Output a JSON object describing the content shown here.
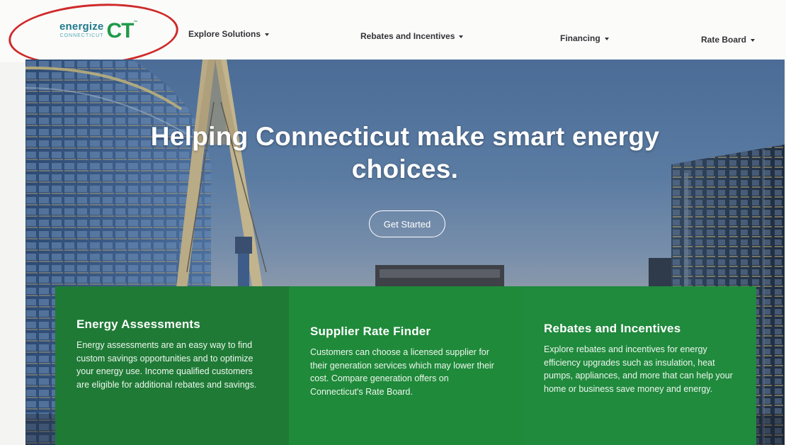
{
  "logo": {
    "word": "energize",
    "sub": "CONNECTICUT",
    "mark": "CT",
    "tm": "™"
  },
  "nav": {
    "items": [
      {
        "label": "Explore Solutions"
      },
      {
        "label": "Rebates and Incentives"
      },
      {
        "label": "Financing"
      },
      {
        "label": "Rate Board"
      }
    ]
  },
  "hero": {
    "title_line1": "Helping Connecticut make smart energy",
    "title_line2": "choices.",
    "cta_label": "Get Started"
  },
  "cards": [
    {
      "title": "Energy Assessments",
      "body": "Energy assessments are an easy way to find custom savings opportunities and to optimize your energy use. Income qualified customers are eligible for additional rebates and savings."
    },
    {
      "title": "Supplier Rate Finder",
      "body": "Customers can choose a licensed supplier for their generation services which may lower their cost. Compare generation offers on Connecticut's Rate Board."
    },
    {
      "title": "Rebates and Incentives",
      "body": "Explore rebates and incentives for energy efficiency upgrades such as insulation, heat pumps, appliances, and more that can help your home or business save money and energy."
    }
  ],
  "colors": {
    "brand_green": "#1f8a3a",
    "brand_teal": "#1f7a8c",
    "annotation_red": "#cf2a2a"
  },
  "icons": [
    "chevron-down-icon"
  ]
}
